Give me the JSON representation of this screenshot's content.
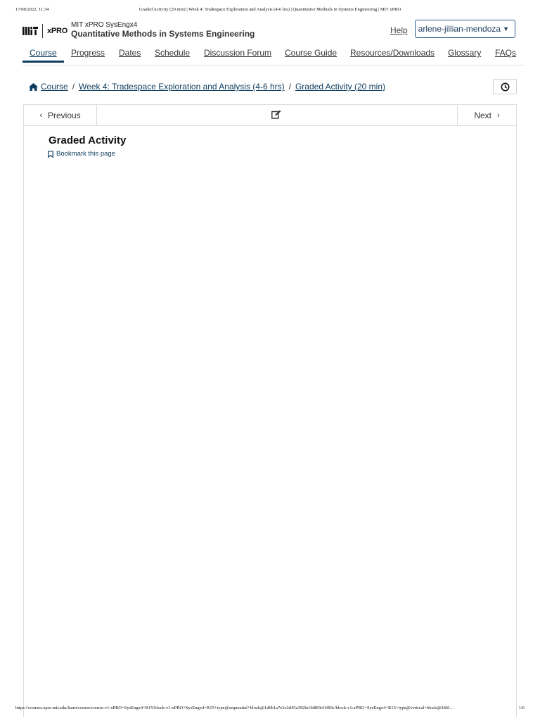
{
  "print": {
    "datetime": "17/08/2022, 11:34",
    "title": "Graded Activity (20 min) | Week 4: Tradespace Exploration and Analysis (4-6 hrs) | Quantitative Methods in Systems Engineering | MIT xPRO",
    "url": "https://courses.xpro.mit.edu/learn/course/course-v1:xPRO+SysEngx4+R15/block-v1:xPRO+SysEngx4+R15+type@sequential+block@1d6b1a7e3c2d45a392fa10d85b41f83c/block-v1:xPRO+SysEngx4+R15+type@vertical+block@2d6f…",
    "page": "1/6"
  },
  "header": {
    "logo_text": "xPRO",
    "org_course": "MIT xPRO SysEngx4",
    "course_name": "Quantitative Methods in Systems Engineering",
    "help": "Help",
    "username": "arlene-jillian-mendoza"
  },
  "tabs": [
    "Course",
    "Progress",
    "Dates",
    "Schedule",
    "Discussion Forum",
    "Course Guide",
    "Resources/Downloads",
    "Glossary",
    "FAQs"
  ],
  "breadcrumb": {
    "course": "Course",
    "section": "Week 4: Tradespace Exploration and Analysis (4-6 hrs)",
    "unit": "Graded Activity (20 min)"
  },
  "sequence": {
    "previous": "Previous",
    "next": "Next"
  },
  "unit": {
    "title": "Graded Activity",
    "bookmark": "Bookmark this page"
  },
  "colors": {
    "accent": "#0e3c5e",
    "border": "#dcdcdc"
  }
}
